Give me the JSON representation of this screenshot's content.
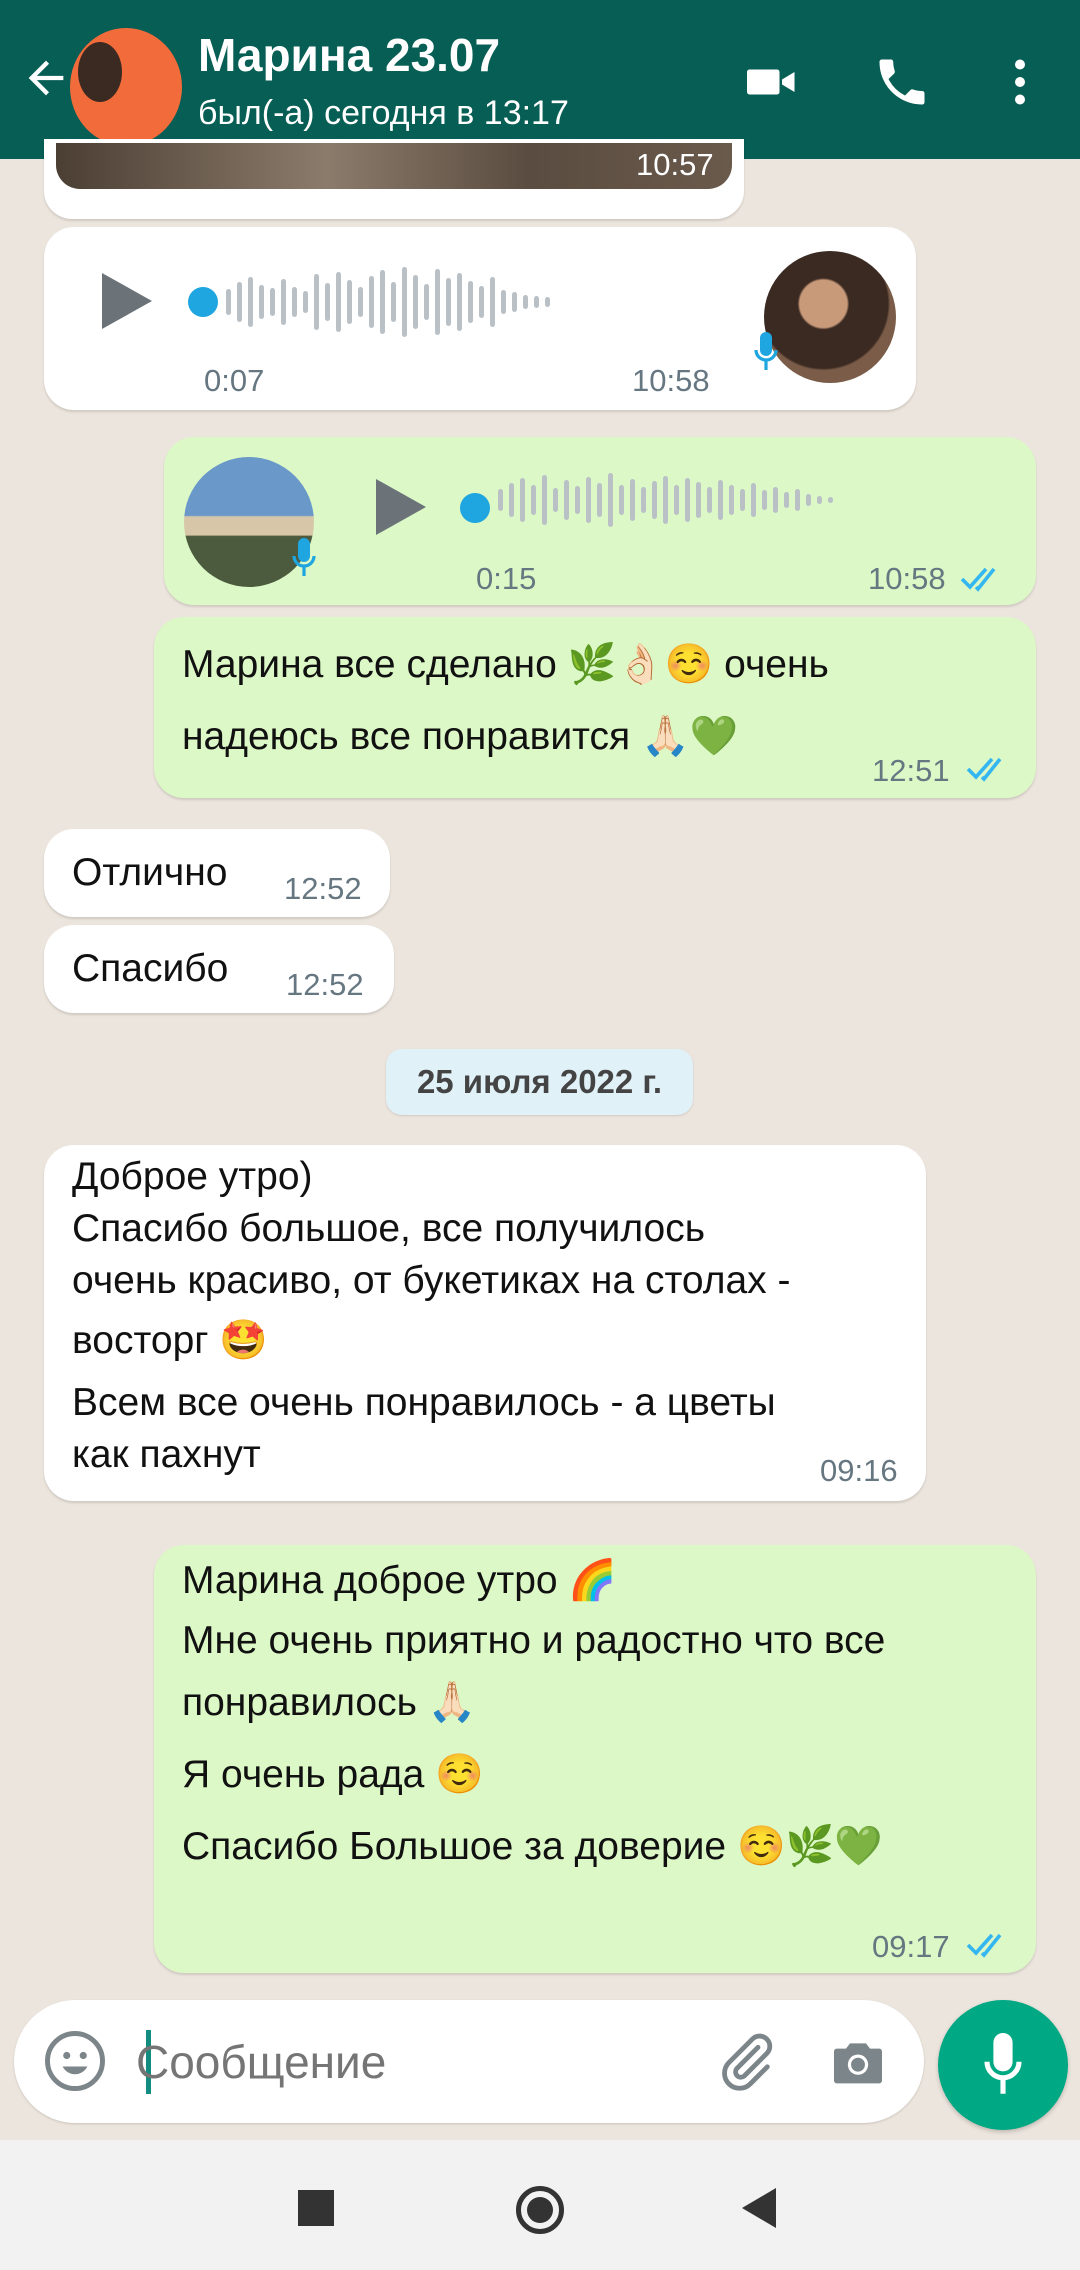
{
  "header": {
    "contact_name": "Марина 23.07",
    "status": "был(-а) сегодня в 13:17"
  },
  "messages": {
    "photo_time": "10:57",
    "voice_in": {
      "duration": "0:07",
      "time": "10:58"
    },
    "voice_out": {
      "duration": "0:15",
      "time": "10:58"
    },
    "out1": {
      "line1": "Марина все сделано 🌿👌🏻☺️ очень",
      "line2": "надеюсь все понравится 🙏🏻💚",
      "time": "12:51"
    },
    "in1": {
      "text": "Отлично",
      "time": "12:52"
    },
    "in2": {
      "text": "Спасибо",
      "time": "12:52"
    },
    "date_separator": "25 июля 2022 г.",
    "in3": {
      "line1": "Доброе утро)",
      "line2": "Спасибо большое, все получилось",
      "line3": "очень красиво, от букетиках на столах -",
      "line4": "восторг 🤩",
      "line5": "Всем все очень понравилось - а цветы",
      "line6": "как пахнут",
      "time": "09:16"
    },
    "out2": {
      "line1": "Марина доброе утро 🌈",
      "line2": "Мне очень приятно и радостно что все",
      "line3": "понравилось 🙏🏻",
      "line4": "Я очень рада ☺️",
      "line5": "Спасибо Большое за доверие ☺️🌿💚",
      "time": "09:17"
    }
  },
  "input": {
    "placeholder": "Сообщение"
  },
  "colors": {
    "header": "#075e54",
    "outgoing": "#dcf8c6",
    "incoming": "#ffffff",
    "accent": "#00a884",
    "ticks": "#34b7f1"
  },
  "icons": [
    "back-arrow-icon",
    "video-call-icon",
    "phone-icon",
    "more-vert-icon",
    "emoji-icon",
    "attach-icon",
    "camera-icon",
    "mic-icon",
    "play-icon",
    "double-check-icon"
  ]
}
